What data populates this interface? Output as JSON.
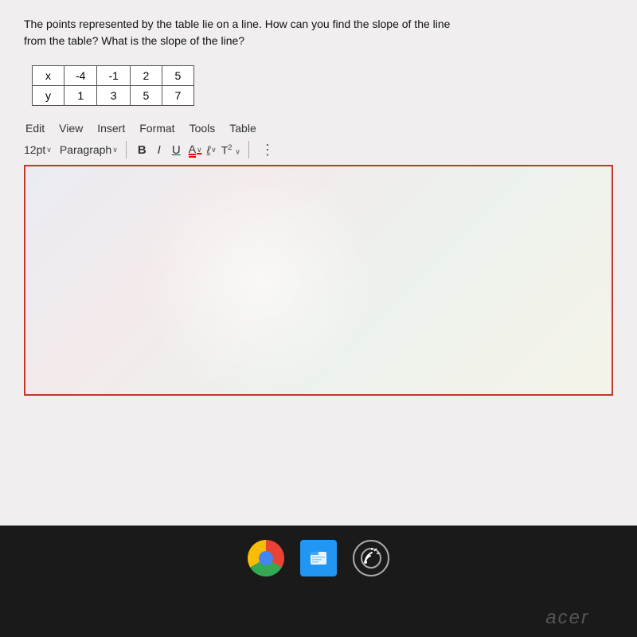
{
  "question": {
    "text_line1": "The points represented by the table lie on a line. How can you find the slope of the line",
    "text_line2": "from the table? What is the slope of the line?"
  },
  "table": {
    "headers": [
      "x",
      "-4",
      "-1",
      "2",
      "5"
    ],
    "row": [
      "y",
      "1",
      "3",
      "5",
      "7"
    ]
  },
  "menu": {
    "items": [
      "Edit",
      "View",
      "Insert",
      "Format",
      "Tools",
      "Table"
    ]
  },
  "toolbar": {
    "font_size": "12pt",
    "font_size_arrow": "∨",
    "paragraph": "Paragraph",
    "paragraph_arrow": "∨",
    "bold_label": "B",
    "italic_label": "I",
    "underline_label": "U",
    "font_color_label": "A",
    "highlight_label": "∠",
    "superscript_label": "T",
    "superscript_num": "2",
    "more_options": "⋮"
  },
  "taskbar": {
    "chrome_label": "Chrome",
    "files_label": "Files",
    "cast_label": "Cast",
    "brand": "acer"
  }
}
